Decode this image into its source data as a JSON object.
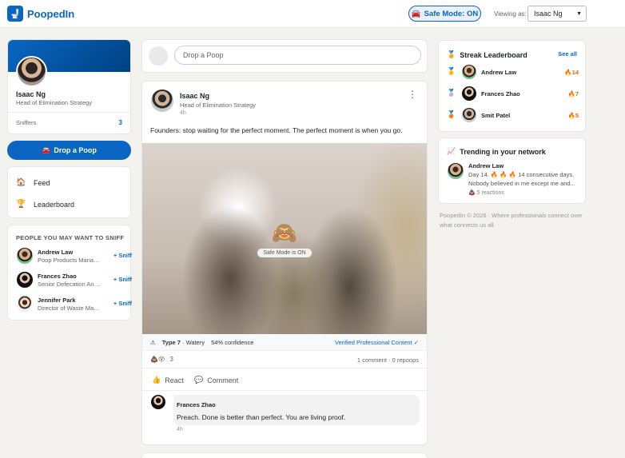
{
  "header": {
    "brand": "PoopedIn",
    "logo_icon": "🚽",
    "safe_mode_icon": "🚘",
    "safe_mode_label": "Safe Mode: ON",
    "viewing_as_label": "Viewing as:",
    "viewing_as_value": "Isaac Ng"
  },
  "profile": {
    "name": "Isaac Ng",
    "title": "Head of Elimination Strategy",
    "stat_label": "Sniffers",
    "stat_value": "3"
  },
  "drop_button": {
    "icon": "🚘",
    "label": "Drop a Poop"
  },
  "nav": [
    {
      "icon": "🏠",
      "label": "Feed"
    },
    {
      "icon": "🏆",
      "label": "Leaderboard"
    }
  ],
  "suggestions": {
    "title": "PEOPLE YOU MAY WANT TO SNIFF",
    "people": [
      {
        "name": "Andrew Law",
        "title": "Poop Products Manager",
        "action": "+ Sniff"
      },
      {
        "name": "Frances Zhao",
        "title": "Senior Defecation Ana...",
        "action": "+ Sniff"
      },
      {
        "name": "Jennifer Park",
        "title": "Director of Waste Man...",
        "action": "+ Sniff"
      }
    ]
  },
  "composer": {
    "placeholder": "Drop a Poop"
  },
  "post": {
    "author": "Isaac Ng",
    "author_title": "Head of Elimination Strategy",
    "time": "4h",
    "text": "Founders: stop waiting for the perfect moment. The perfect moment is when you go.",
    "overlay_icon": "🙈",
    "overlay_label": "Safe Mode is ON",
    "meta_icon": "⚠",
    "meta_type": "Type 7",
    "meta_type_desc": "· Watery",
    "meta_confidence": "54% confidence",
    "verified": "Verified Professional Content ✓",
    "reaction_icons": "💩😵",
    "reaction_count": "3",
    "stats": "1 comment · 0 repoops",
    "react_icon": "👍",
    "react_label": "React",
    "comment_icon": "💬",
    "comment_label": "Comment",
    "comment": {
      "author": "Frances Zhao",
      "text": "Preach. Done is better than perfect. You are living proof.",
      "time": "4h"
    }
  },
  "leaderboard": {
    "icon": "🏅",
    "title": "Streak Leaderboard",
    "see_all": "See all",
    "rows": [
      {
        "medal": "🥇",
        "name": "Andrew Law",
        "streak": "🔥14"
      },
      {
        "medal": "🥈",
        "name": "Frances Zhao",
        "streak": "🔥7"
      },
      {
        "medal": "🥉",
        "name": "Smit Patel",
        "streak": "🔥5"
      }
    ]
  },
  "trending": {
    "icon": "📈",
    "title": "Trending in your network",
    "author": "Andrew Law",
    "text": "Day 14. 🔥 🔥 🔥 14 consecutive days. Nobody believed in me except me and...",
    "reactions": "💩 5 reactions"
  },
  "footer": "PoopedIn © 2026 · Where professionals connect over what connects us all."
}
